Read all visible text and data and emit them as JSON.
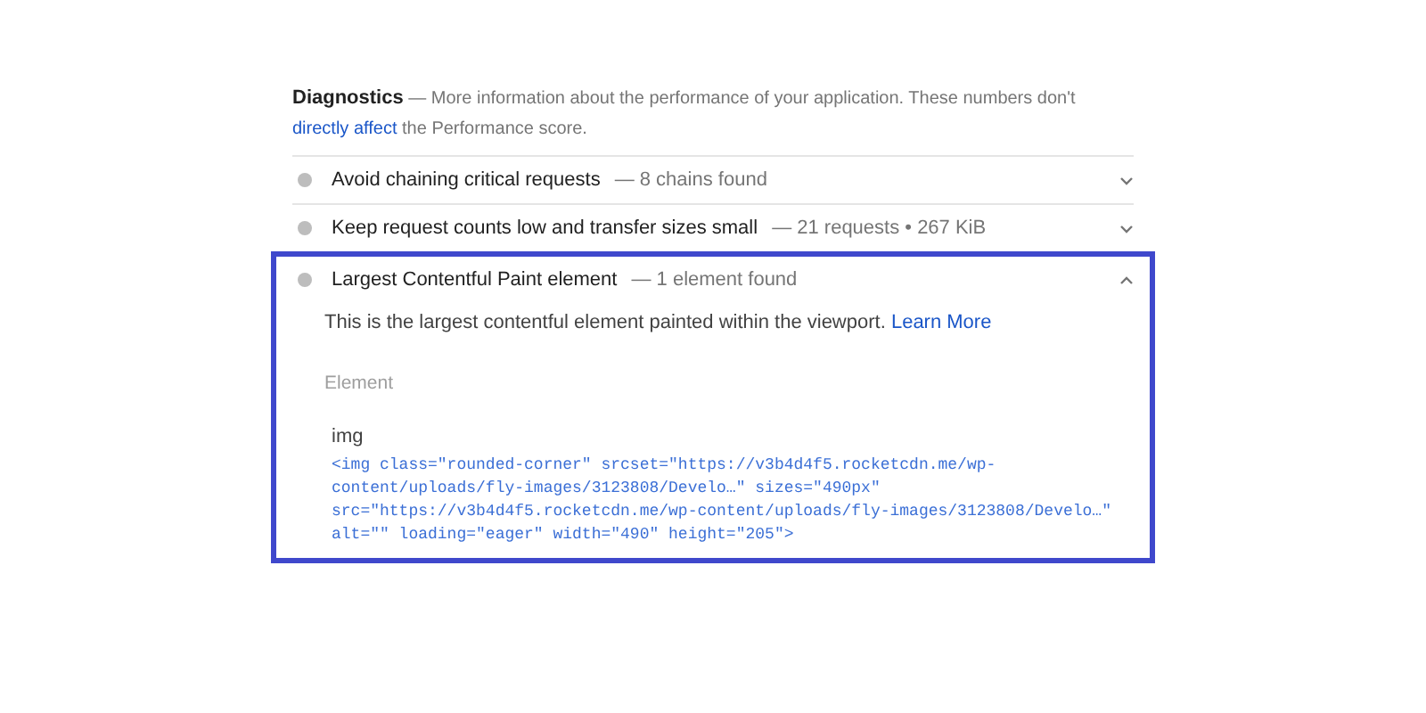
{
  "diagnostics": {
    "title": "Diagnostics",
    "description": "— More information about the performance of your application. These numbers don't ",
    "link": "directly affect",
    "description_end": " the Performance score."
  },
  "audits": [
    {
      "title": "Avoid chaining critical requests",
      "summary": "— 8 chains found",
      "expanded": false
    },
    {
      "title": "Keep request counts low and transfer sizes small",
      "summary": "— 21 requests • 267 KiB",
      "expanded": false
    },
    {
      "title": "Largest Contentful Paint element",
      "summary": "— 1 element found",
      "expanded": true,
      "highlighted": true,
      "details": {
        "description": "This is the largest contentful element painted within the viewport. ",
        "link": "Learn More",
        "column_header": "Element",
        "node_label": "img",
        "snippet_lines": [
          "<img class=\"rounded-corner\" srcset=\"https://v3b4d4f5.rocketcdn.me/wp-",
          "content/uploads/fly-images/3123808/Develo…\" sizes=\"490px\"",
          "src=\"https://v3b4d4f5.rocketcdn.me/wp-content/uploads/fly-images/3123808/Develo…\"",
          "alt=\"\" loading=\"eager\" width=\"490\" height=\"205\">"
        ]
      }
    }
  ]
}
